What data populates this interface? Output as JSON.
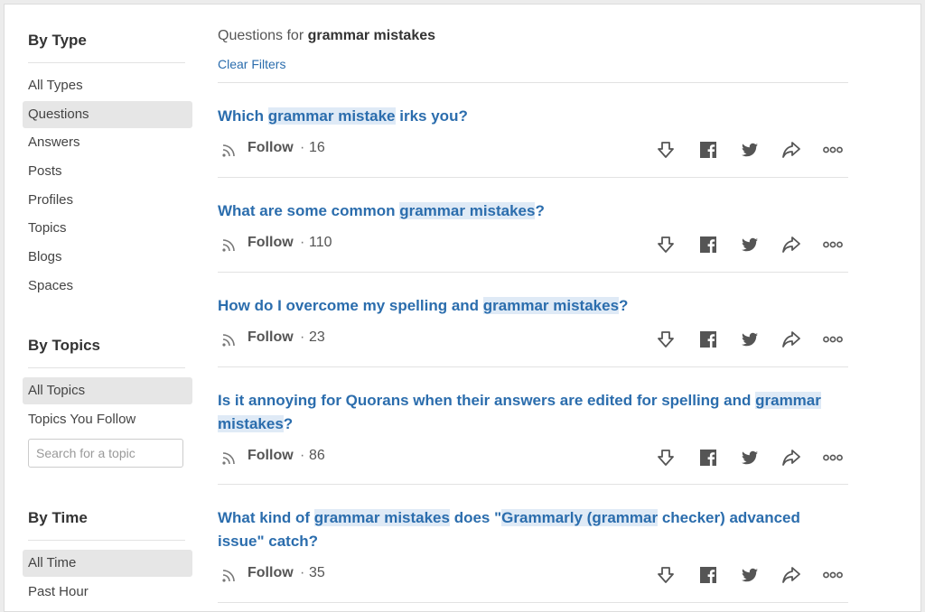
{
  "sidebar": {
    "by_type": {
      "title": "By Type",
      "items": [
        "All Types",
        "Questions",
        "Answers",
        "Posts",
        "Profiles",
        "Topics",
        "Blogs",
        "Spaces"
      ],
      "active_index": 1
    },
    "by_topics": {
      "title": "By Topics",
      "items": [
        "All Topics",
        "Topics You Follow"
      ],
      "active_index": 0,
      "search_placeholder": "Search for a topic"
    },
    "by_time": {
      "title": "By Time",
      "items": [
        "All Time",
        "Past Hour"
      ],
      "active_index": 0
    }
  },
  "main": {
    "heading_prefix": "Questions for",
    "heading_query": "grammar mistakes",
    "clear_filters": "Clear Filters",
    "questions": [
      {
        "title_parts": [
          {
            "text": "Which ",
            "hl": false
          },
          {
            "text": "grammar mistake",
            "hl": true
          },
          {
            "text": " irks you?",
            "hl": false
          }
        ],
        "follow_label": "Follow",
        "follow_count": "16"
      },
      {
        "title_parts": [
          {
            "text": "What are some common ",
            "hl": false
          },
          {
            "text": "grammar mistakes",
            "hl": true
          },
          {
            "text": "?",
            "hl": false
          }
        ],
        "follow_label": "Follow",
        "follow_count": "110"
      },
      {
        "title_parts": [
          {
            "text": "How do I overcome my spelling and ",
            "hl": false
          },
          {
            "text": "grammar mistakes",
            "hl": true
          },
          {
            "text": "?",
            "hl": false
          }
        ],
        "follow_label": "Follow",
        "follow_count": "23"
      },
      {
        "title_parts": [
          {
            "text": "Is it annoying for Quorans when their answers are edited for spelling and ",
            "hl": false
          },
          {
            "text": "grammar mistakes",
            "hl": true
          },
          {
            "text": "?",
            "hl": false
          }
        ],
        "follow_label": "Follow",
        "follow_count": "86"
      },
      {
        "title_parts": [
          {
            "text": "What kind of ",
            "hl": false
          },
          {
            "text": "grammar mistakes",
            "hl": true
          },
          {
            "text": " does \"",
            "hl": false
          },
          {
            "text": "Grammarly (grammar",
            "hl": true
          },
          {
            "text": " checker) advanced issue\" catch?",
            "hl": false
          }
        ],
        "follow_label": "Follow",
        "follow_count": "35"
      }
    ],
    "actions": [
      "downvote-icon",
      "facebook-icon",
      "twitter-icon",
      "share-icon",
      "more-icon"
    ]
  },
  "colors": {
    "link": "#2b6dad",
    "highlight": "#dfeaf6",
    "active_bg": "#e6e6e6"
  }
}
